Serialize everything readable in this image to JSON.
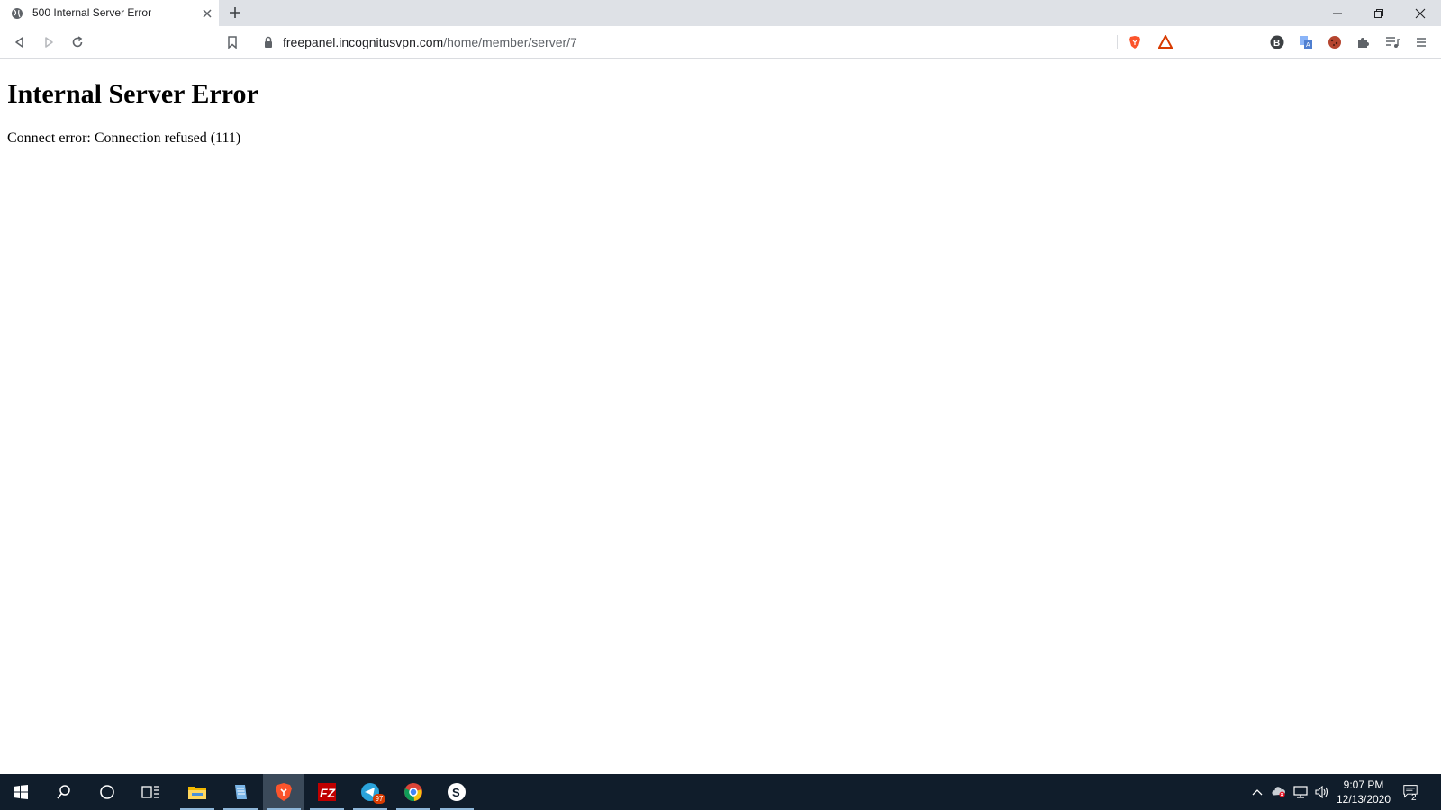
{
  "browser": {
    "tab": {
      "title": "500 Internal Server Error"
    },
    "url": {
      "host": "freepanel.incognitusvpn.com",
      "path": "/home/member/server/7"
    }
  },
  "page": {
    "heading": "Internal Server Error",
    "message": "Connect error: Connection refused (111)"
  },
  "taskbar": {
    "apps": [
      {
        "name": "file-explorer-icon"
      },
      {
        "name": "notepad-icon"
      },
      {
        "name": "brave-browser-icon"
      },
      {
        "name": "filezilla-icon"
      },
      {
        "name": "telegram-icon",
        "badge": "97"
      },
      {
        "name": "chrome-app-icon"
      },
      {
        "name": "skype-icon"
      }
    ],
    "clock": {
      "time": "9:07 PM",
      "date": "12/13/2020"
    },
    "notifications": {
      "count": "2"
    }
  },
  "colors": {
    "tabstrip": "#dee1e6",
    "taskbar": "#101d2b",
    "brave_orange": "#fb542b"
  }
}
